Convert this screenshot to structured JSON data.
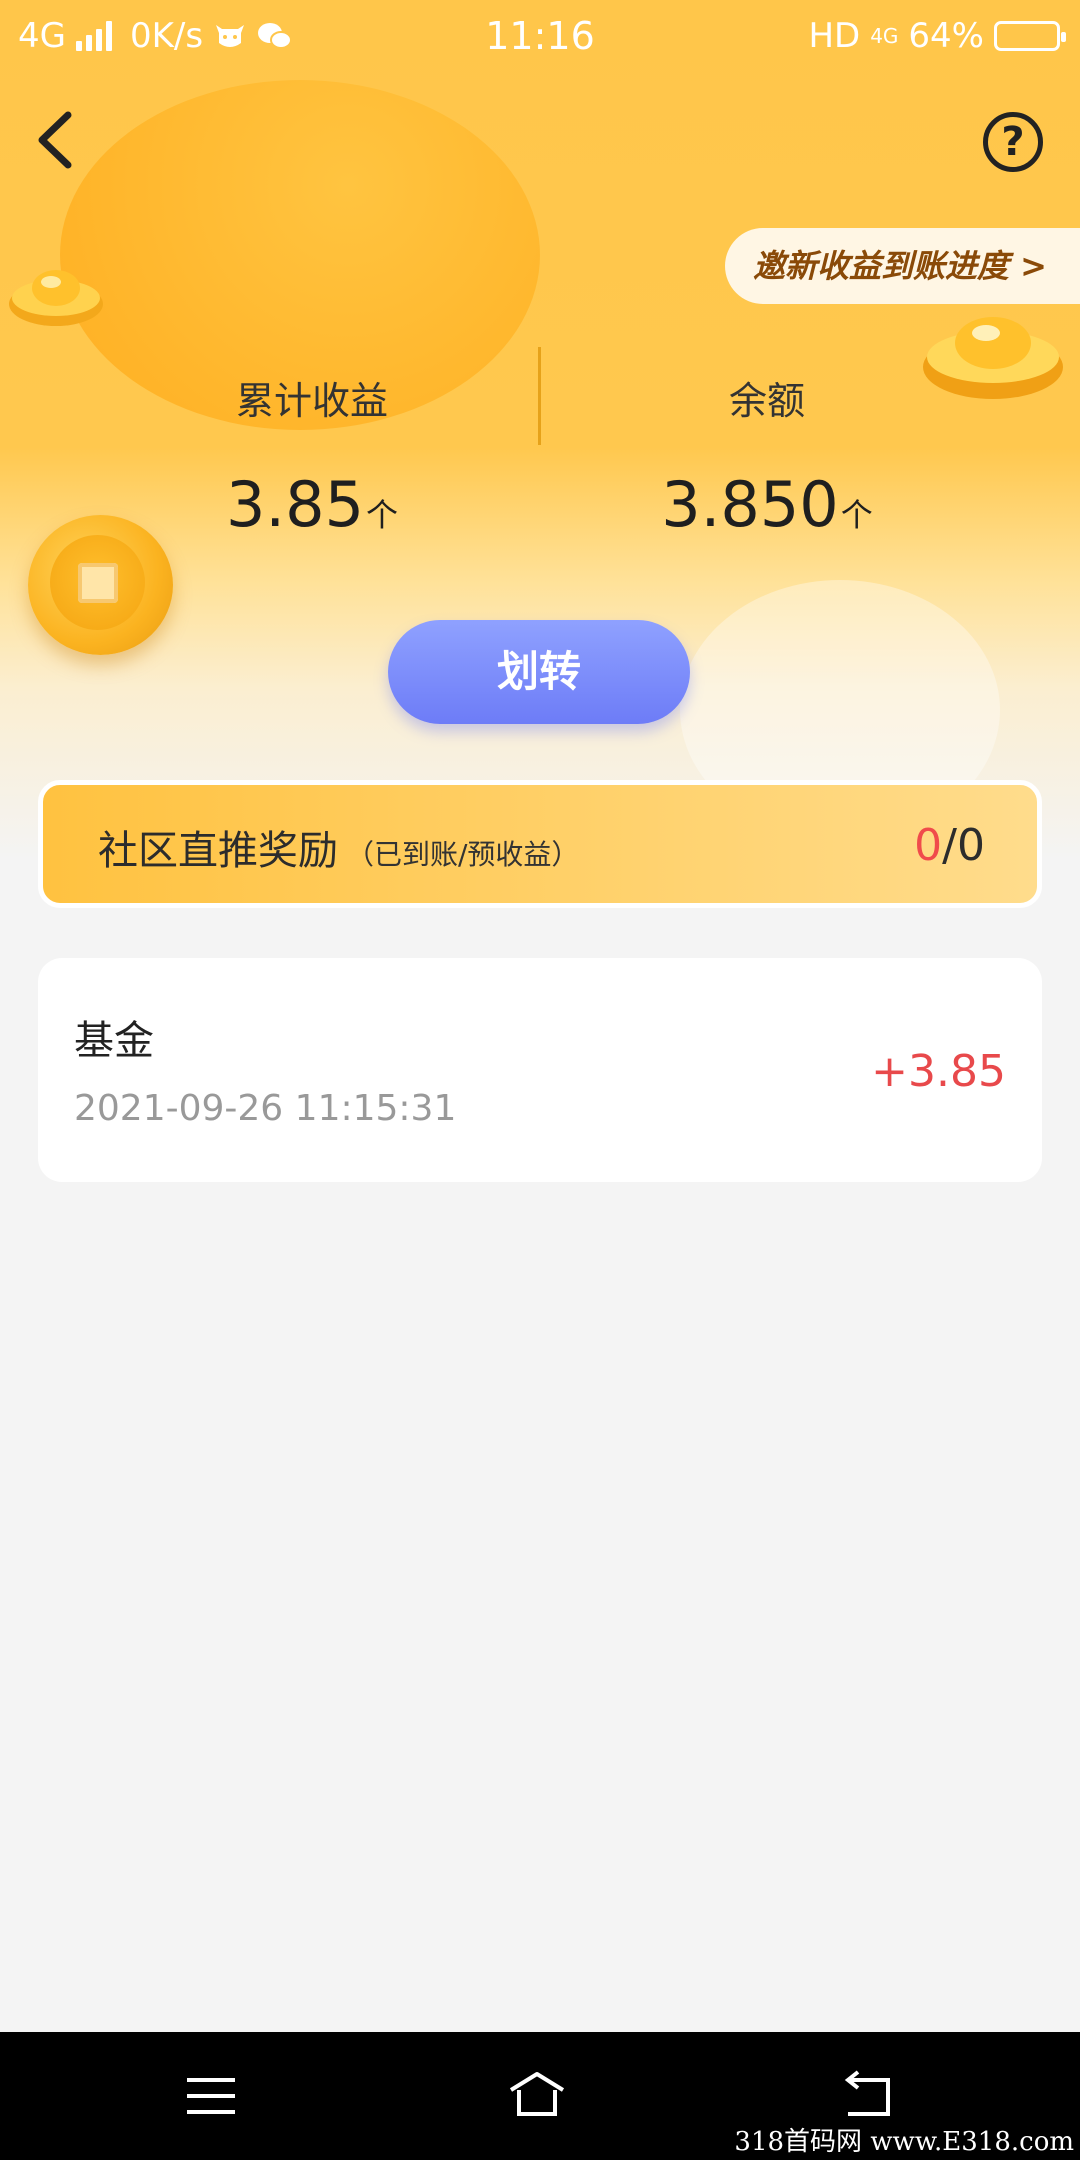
{
  "status_bar": {
    "network": "4G",
    "speed": "0K/s",
    "time": "11:16",
    "hd": "HD",
    "net_type": "4G",
    "battery": "64%",
    "battery_level": 0.64
  },
  "header": {
    "back_icon": "chevron-left-icon",
    "help_icon": "question-circle-icon",
    "help_symbol": "?"
  },
  "invite": {
    "label": "邀新收益到账进度 >"
  },
  "stats": {
    "left": {
      "label": "累计收益",
      "value": "3.85",
      "unit": "个"
    },
    "right": {
      "label": "余额",
      "value": "3.850",
      "unit": "个"
    }
  },
  "transfer_button": {
    "label": "划转"
  },
  "reward": {
    "title": "社区直推奖励",
    "subtitle": "（已到账/预收益）",
    "received": "0",
    "separator": "/",
    "expected": "0"
  },
  "transactions": [
    {
      "title": "基金",
      "time": "2021-09-26 11:15:31",
      "amount": "+3.85"
    }
  ],
  "nav_bar": {
    "menu_icon": "menu-icon",
    "home_icon": "home-icon",
    "back_icon": "back-arrow-icon"
  },
  "watermark": "318首码网 www.E318.com",
  "colors": {
    "accent": "#ffc64a",
    "button": "#7b8af9",
    "positive": "#e8494b"
  }
}
